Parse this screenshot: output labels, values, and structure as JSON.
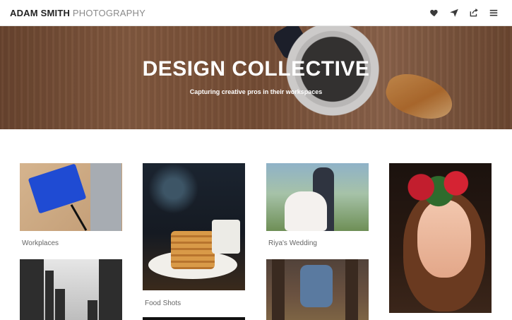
{
  "header": {
    "brand_bold": "ADAM SMITH",
    "brand_light": " PHOTOGRAPHY",
    "icons": [
      "heart-icon",
      "send-icon",
      "share-icon",
      "menu-icon"
    ]
  },
  "hero": {
    "title": "DESIGN COLLECTIVE",
    "subtitle": "Capturing creative pros in their workspaces"
  },
  "gallery": {
    "items": [
      {
        "label": "Workplaces"
      },
      {
        "label": "Food Shots"
      },
      {
        "label": "Riya's Wedding"
      },
      {
        "label": ""
      },
      {
        "label": ""
      },
      {
        "label": ""
      },
      {
        "label": ""
      }
    ]
  },
  "colors": {
    "brand_text": "#222222",
    "muted_text": "#8a8a8a",
    "caption_text": "#666666"
  }
}
